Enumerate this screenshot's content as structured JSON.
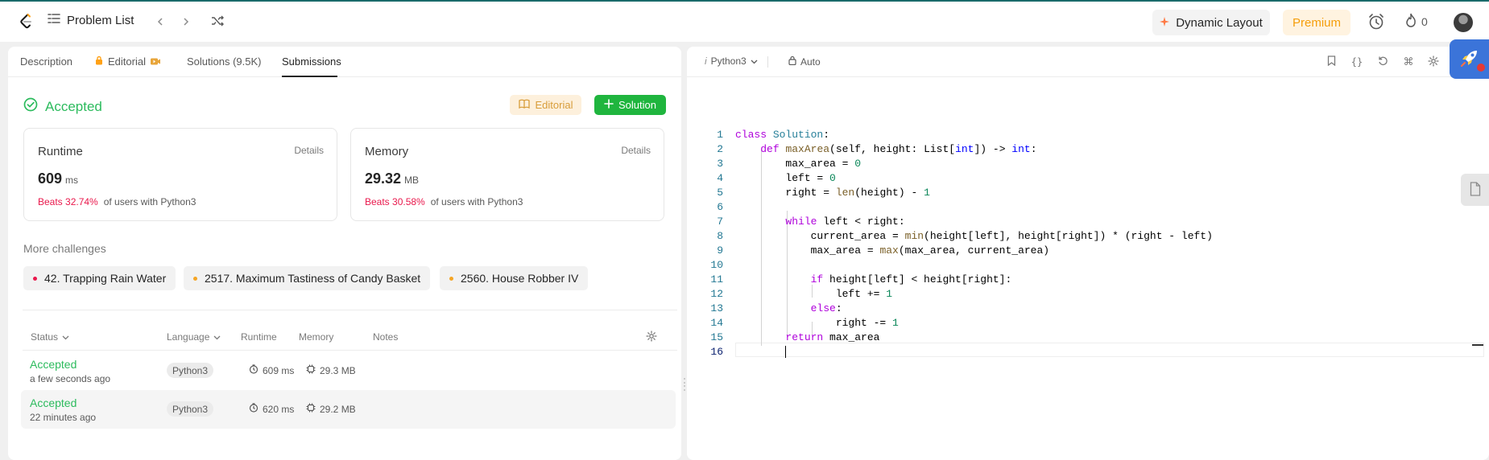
{
  "topbar": {
    "problem_list": "Problem List",
    "dynamic_layout": "Dynamic Layout",
    "premium": "Premium",
    "streak_count": "0"
  },
  "left_tabs": {
    "description": "Description",
    "editorial": "Editorial",
    "solutions": "Solutions (9.5K)",
    "submissions": "Submissions"
  },
  "result": {
    "status": "Accepted",
    "editorial_button": "Editorial",
    "solution_button": "Solution"
  },
  "runtime": {
    "title": "Runtime",
    "details": "Details",
    "value": "609",
    "unit": "ms",
    "beats_pct": "Beats 32.74%",
    "beats_text": "of users with Python3"
  },
  "memory": {
    "title": "Memory",
    "details": "Details",
    "value": "29.32",
    "unit": "MB",
    "beats_pct": "Beats 30.58%",
    "beats_text": "of users with Python3"
  },
  "more_challenges": {
    "title": "More challenges",
    "items": [
      {
        "label": "42. Trapping Rain Water",
        "color": "#e9184c"
      },
      {
        "label": "2517. Maximum Tastiness of Candy Basket",
        "color": "#f5a524"
      },
      {
        "label": "2560. House Robber IV",
        "color": "#f5a524"
      }
    ]
  },
  "table": {
    "headers": [
      "Status",
      "Language",
      "Runtime",
      "Memory",
      "Notes"
    ],
    "rows": [
      {
        "status": "Accepted",
        "time": "a few seconds ago",
        "language": "Python3",
        "runtime": "609 ms",
        "memory": "29.3 MB"
      },
      {
        "status": "Accepted",
        "time": "22 minutes ago",
        "language": "Python3",
        "runtime": "620 ms",
        "memory": "29.2 MB"
      }
    ]
  },
  "editor": {
    "language": "Python3",
    "mode": "Auto",
    "line_numbers": [
      "1",
      "2",
      "3",
      "4",
      "5",
      "6",
      "7",
      "8",
      "9",
      "10",
      "11",
      "12",
      "13",
      "14",
      "15",
      "16"
    ],
    "code_lines": [
      "class Solution:",
      "    def maxArea(self, height: List[int]) -> int:",
      "        max_area = 0",
      "        left = 0",
      "        right = len(height) - 1",
      "",
      "        while left < right:",
      "            current_area = min(height[left], height[right]) * (right - left)",
      "            max_area = max(max_area, current_area)",
      "",
      "            if height[left] < height[right]:",
      "                left += 1",
      "            else:",
      "                right -= 1",
      "        return max_area",
      "        "
    ]
  },
  "colors": {
    "accent_green": "#2cbb5d",
    "solution_green": "#1fb53e",
    "beats_red": "#e9184c",
    "premium_orange": "#f59e0b",
    "rocket_blue": "#3b74d9"
  },
  "icons": [
    "leetcode-logo",
    "list-icon",
    "chevron-left-icon",
    "chevron-right-icon",
    "shuffle-icon",
    "sparkle-icon",
    "alarm-icon",
    "flame-icon",
    "lock-icon",
    "video-icon",
    "check-circle-icon",
    "book-icon",
    "plus-icon",
    "chevron-down-icon",
    "settings-icon",
    "clock-icon",
    "chip-icon",
    "bookmark-icon",
    "braces-icon",
    "reset-icon",
    "command-icon",
    "rocket-icon",
    "document-icon"
  ]
}
